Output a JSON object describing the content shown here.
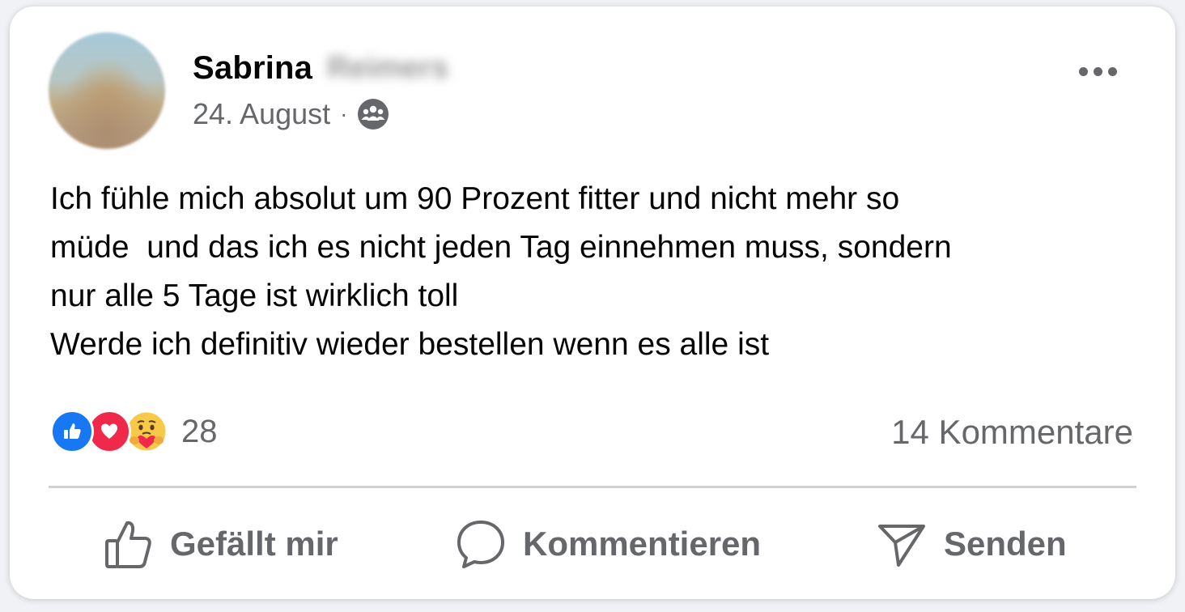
{
  "post": {
    "author_first": "Sabrina",
    "author_last_blurred": "Reimers",
    "date": "24. August",
    "separator": "·",
    "audience_icon": "group-icon",
    "more_icon": "more-options-icon",
    "text_lines": [
      "Ich fühle mich absolut um 90 Prozent fitter und nicht mehr so",
      "müde  und das ich es nicht jeden Tag einnehmen muss, sondern",
      "nur alle 5 Tage ist wirklich toll",
      "Werde ich definitiv wieder bestellen wenn es alle ist"
    ]
  },
  "reactions": {
    "types": [
      "like",
      "love",
      "care"
    ],
    "count": "28"
  },
  "comments": {
    "label": "14 Kommentare"
  },
  "actions": {
    "like_label": "Gefällt mir",
    "comment_label": "Kommentieren",
    "send_label": "Senden"
  },
  "colors": {
    "like_blue": "#1877f2",
    "love_red": "#f0284a",
    "care_yellow": "#f7c94a",
    "secondary_text": "#65676b"
  }
}
